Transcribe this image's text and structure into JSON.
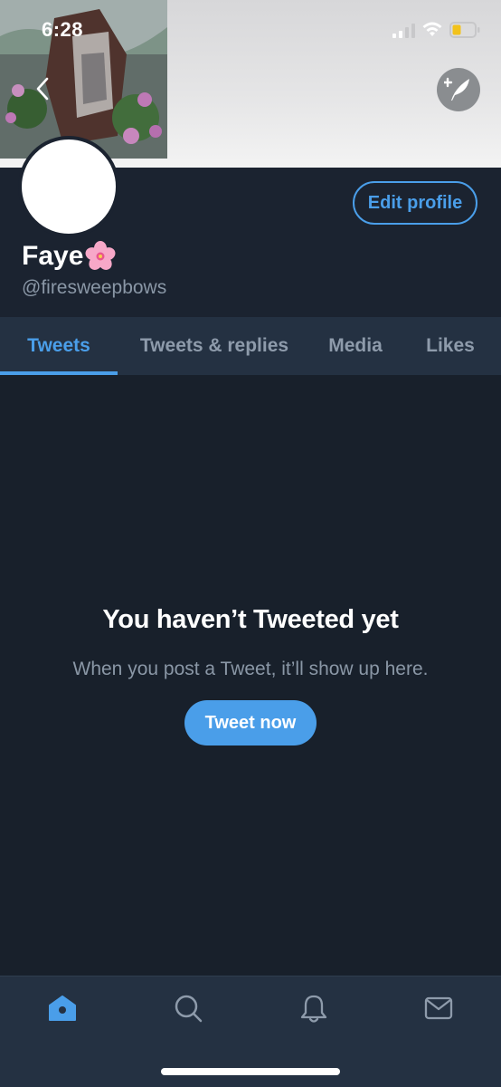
{
  "status_bar": {
    "time": "6:28"
  },
  "profile": {
    "display_name": "Faye",
    "handle": "@firesweepbows",
    "edit_profile_label": "Edit profile"
  },
  "tabs": [
    {
      "label": "Tweets",
      "active": true
    },
    {
      "label": "Tweets & replies",
      "active": false
    },
    {
      "label": "Media",
      "active": false
    },
    {
      "label": "Likes",
      "active": false
    }
  ],
  "empty_state": {
    "title": "You haven’t Tweeted yet",
    "subtitle": "When you post a Tweet, it’ll show up here.",
    "button_label": "Tweet now"
  },
  "bottom_nav": [
    {
      "icon": "home-icon",
      "active": true
    },
    {
      "icon": "search-icon",
      "active": false
    },
    {
      "icon": "notifications-icon",
      "active": false
    },
    {
      "icon": "messages-icon",
      "active": false
    }
  ],
  "colors": {
    "accent": "#4a9ee9",
    "background": "#18202b",
    "surface": "#243142",
    "muted_text": "#8a97a6"
  }
}
